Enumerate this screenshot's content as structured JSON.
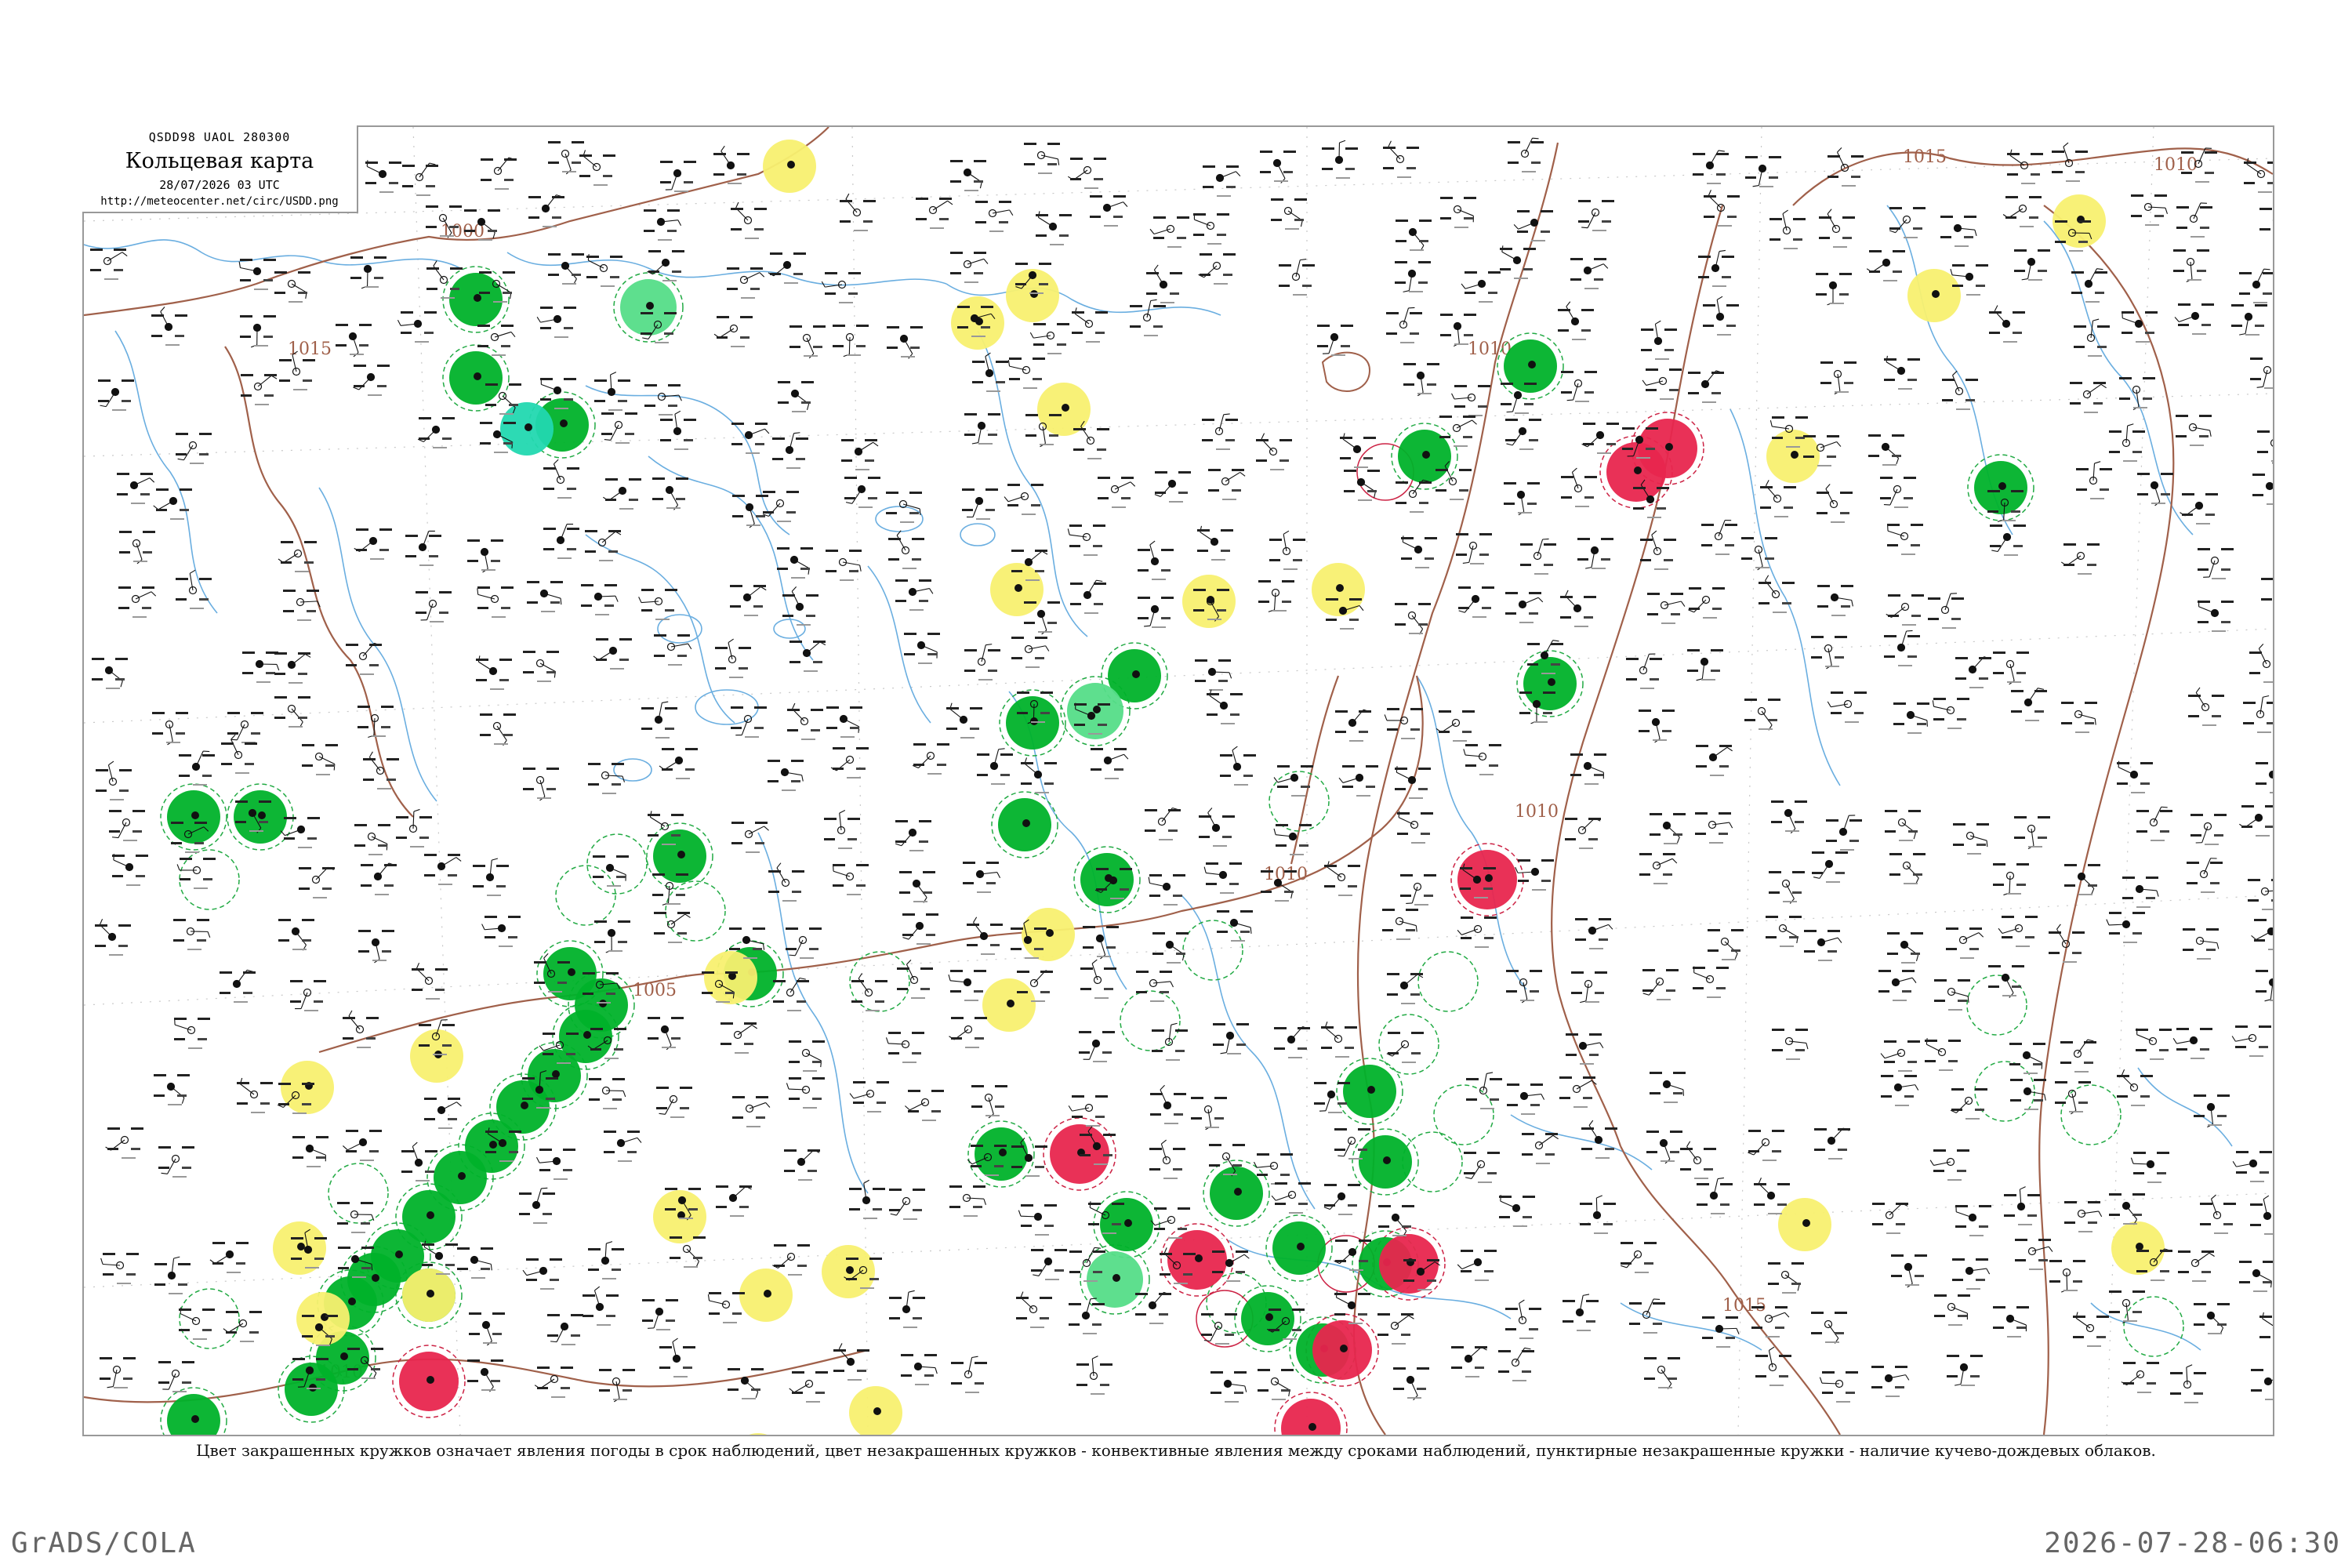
{
  "title": {
    "code": "QSDD98  UAOL  280300",
    "name": "Кольцевая карта",
    "date": "28/07/2026 03 UTC",
    "url": "http://meteocenter.net/circ/USDD.png"
  },
  "caption": "Цвет закрашенных кружков означает явления погоды в срок наблюдений, цвет незакрашенных кружков - конвективные явления между сроками наблюдений, пунктирные незакрашенные кружки - наличие кучево-дождевых облаков.",
  "footer": {
    "left": "GrADS/COLA",
    "right": "2026-07-28-06:30"
  },
  "colors": {
    "isobar": "#a0604a",
    "water": "#6aaee0",
    "green": "#00b22a",
    "light_green": "#55dd88",
    "cyan": "#22d8b0",
    "yellow": "#f8f070",
    "red": "#e8264e",
    "ring_green": "#22aa44",
    "ring_red": "#cc2244"
  },
  "isobars": [
    {
      "label": "1000"
    },
    {
      "label": "1005"
    },
    {
      "label": "1010"
    },
    {
      "label": "1015"
    }
  ],
  "circles": [
    {
      "type": "green"
    },
    {
      "type": "green"
    },
    {
      "type": "green"
    },
    {
      "type": "green"
    },
    {
      "type": "green"
    },
    {
      "type": "green"
    },
    {
      "type": "green"
    },
    {
      "type": "green"
    },
    {
      "type": "green"
    },
    {
      "type": "green"
    },
    {
      "type": "green"
    },
    {
      "type": "green"
    },
    {
      "type": "green"
    },
    {
      "type": "green"
    },
    {
      "type": "green"
    },
    {
      "type": "green"
    },
    {
      "type": "green"
    },
    {
      "type": "green"
    },
    {
      "type": "green"
    },
    {
      "type": "green"
    },
    {
      "type": "green"
    },
    {
      "type": "green"
    },
    {
      "type": "green"
    },
    {
      "type": "green"
    },
    {
      "type": "green"
    },
    {
      "type": "green"
    },
    {
      "type": "green"
    },
    {
      "type": "green"
    },
    {
      "type": "green"
    },
    {
      "type": "green"
    },
    {
      "type": "green"
    },
    {
      "type": "green"
    },
    {
      "type": "green"
    },
    {
      "type": "green"
    },
    {
      "type": "green"
    },
    {
      "type": "green"
    },
    {
      "type": "green"
    },
    {
      "type": "green"
    },
    {
      "type": "green"
    },
    {
      "type": "light_green"
    },
    {
      "type": "light_green"
    },
    {
      "type": "light_green"
    },
    {
      "type": "cyan"
    },
    {
      "type": "yellow"
    },
    {
      "type": "yellow"
    },
    {
      "type": "yellow"
    },
    {
      "type": "yellow"
    },
    {
      "type": "yellow"
    },
    {
      "type": "yellow"
    },
    {
      "type": "yellow"
    },
    {
      "type": "yellow"
    },
    {
      "type": "yellow"
    },
    {
      "type": "yellow"
    },
    {
      "type": "yellow"
    },
    {
      "type": "yellow"
    },
    {
      "type": "yellow"
    },
    {
      "type": "yellow"
    },
    {
      "type": "yellow"
    },
    {
      "type": "yellow"
    },
    {
      "type": "yellow"
    },
    {
      "type": "yellow"
    },
    {
      "type": "yellow"
    },
    {
      "type": "yellow"
    },
    {
      "type": "yellow"
    },
    {
      "type": "yellow"
    },
    {
      "type": "yellow"
    },
    {
      "type": "yellow"
    },
    {
      "type": "yellow"
    },
    {
      "type": "red"
    },
    {
      "type": "red"
    },
    {
      "type": "red"
    },
    {
      "type": "red"
    },
    {
      "type": "red"
    },
    {
      "type": "red"
    },
    {
      "type": "red"
    },
    {
      "type": "red"
    },
    {
      "type": "red"
    }
  ]
}
